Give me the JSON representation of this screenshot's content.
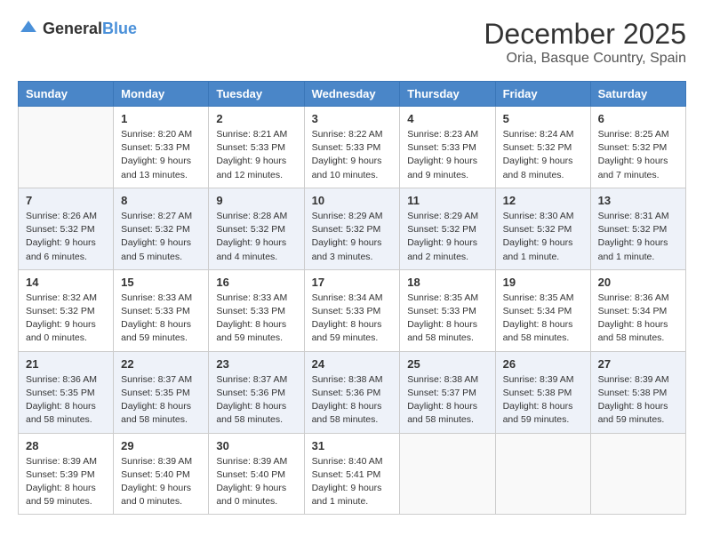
{
  "logo": {
    "general": "General",
    "blue": "Blue"
  },
  "title": {
    "month": "December 2025",
    "location": "Oria, Basque Country, Spain"
  },
  "headers": [
    "Sunday",
    "Monday",
    "Tuesday",
    "Wednesday",
    "Thursday",
    "Friday",
    "Saturday"
  ],
  "weeks": [
    [
      {
        "day": "",
        "info": ""
      },
      {
        "day": "1",
        "info": "Sunrise: 8:20 AM\nSunset: 5:33 PM\nDaylight: 9 hours\nand 13 minutes."
      },
      {
        "day": "2",
        "info": "Sunrise: 8:21 AM\nSunset: 5:33 PM\nDaylight: 9 hours\nand 12 minutes."
      },
      {
        "day": "3",
        "info": "Sunrise: 8:22 AM\nSunset: 5:33 PM\nDaylight: 9 hours\nand 10 minutes."
      },
      {
        "day": "4",
        "info": "Sunrise: 8:23 AM\nSunset: 5:33 PM\nDaylight: 9 hours\nand 9 minutes."
      },
      {
        "day": "5",
        "info": "Sunrise: 8:24 AM\nSunset: 5:32 PM\nDaylight: 9 hours\nand 8 minutes."
      },
      {
        "day": "6",
        "info": "Sunrise: 8:25 AM\nSunset: 5:32 PM\nDaylight: 9 hours\nand 7 minutes."
      }
    ],
    [
      {
        "day": "7",
        "info": "Sunrise: 8:26 AM\nSunset: 5:32 PM\nDaylight: 9 hours\nand 6 minutes."
      },
      {
        "day": "8",
        "info": "Sunrise: 8:27 AM\nSunset: 5:32 PM\nDaylight: 9 hours\nand 5 minutes."
      },
      {
        "day": "9",
        "info": "Sunrise: 8:28 AM\nSunset: 5:32 PM\nDaylight: 9 hours\nand 4 minutes."
      },
      {
        "day": "10",
        "info": "Sunrise: 8:29 AM\nSunset: 5:32 PM\nDaylight: 9 hours\nand 3 minutes."
      },
      {
        "day": "11",
        "info": "Sunrise: 8:29 AM\nSunset: 5:32 PM\nDaylight: 9 hours\nand 2 minutes."
      },
      {
        "day": "12",
        "info": "Sunrise: 8:30 AM\nSunset: 5:32 PM\nDaylight: 9 hours\nand 1 minute."
      },
      {
        "day": "13",
        "info": "Sunrise: 8:31 AM\nSunset: 5:32 PM\nDaylight: 9 hours\nand 1 minute."
      }
    ],
    [
      {
        "day": "14",
        "info": "Sunrise: 8:32 AM\nSunset: 5:32 PM\nDaylight: 9 hours\nand 0 minutes."
      },
      {
        "day": "15",
        "info": "Sunrise: 8:33 AM\nSunset: 5:33 PM\nDaylight: 8 hours\nand 59 minutes."
      },
      {
        "day": "16",
        "info": "Sunrise: 8:33 AM\nSunset: 5:33 PM\nDaylight: 8 hours\nand 59 minutes."
      },
      {
        "day": "17",
        "info": "Sunrise: 8:34 AM\nSunset: 5:33 PM\nDaylight: 8 hours\nand 59 minutes."
      },
      {
        "day": "18",
        "info": "Sunrise: 8:35 AM\nSunset: 5:33 PM\nDaylight: 8 hours\nand 58 minutes."
      },
      {
        "day": "19",
        "info": "Sunrise: 8:35 AM\nSunset: 5:34 PM\nDaylight: 8 hours\nand 58 minutes."
      },
      {
        "day": "20",
        "info": "Sunrise: 8:36 AM\nSunset: 5:34 PM\nDaylight: 8 hours\nand 58 minutes."
      }
    ],
    [
      {
        "day": "21",
        "info": "Sunrise: 8:36 AM\nSunset: 5:35 PM\nDaylight: 8 hours\nand 58 minutes."
      },
      {
        "day": "22",
        "info": "Sunrise: 8:37 AM\nSunset: 5:35 PM\nDaylight: 8 hours\nand 58 minutes."
      },
      {
        "day": "23",
        "info": "Sunrise: 8:37 AM\nSunset: 5:36 PM\nDaylight: 8 hours\nand 58 minutes."
      },
      {
        "day": "24",
        "info": "Sunrise: 8:38 AM\nSunset: 5:36 PM\nDaylight: 8 hours\nand 58 minutes."
      },
      {
        "day": "25",
        "info": "Sunrise: 8:38 AM\nSunset: 5:37 PM\nDaylight: 8 hours\nand 58 minutes."
      },
      {
        "day": "26",
        "info": "Sunrise: 8:39 AM\nSunset: 5:38 PM\nDaylight: 8 hours\nand 59 minutes."
      },
      {
        "day": "27",
        "info": "Sunrise: 8:39 AM\nSunset: 5:38 PM\nDaylight: 8 hours\nand 59 minutes."
      }
    ],
    [
      {
        "day": "28",
        "info": "Sunrise: 8:39 AM\nSunset: 5:39 PM\nDaylight: 8 hours\nand 59 minutes."
      },
      {
        "day": "29",
        "info": "Sunrise: 8:39 AM\nSunset: 5:40 PM\nDaylight: 9 hours\nand 0 minutes."
      },
      {
        "day": "30",
        "info": "Sunrise: 8:39 AM\nSunset: 5:40 PM\nDaylight: 9 hours\nand 0 minutes."
      },
      {
        "day": "31",
        "info": "Sunrise: 8:40 AM\nSunset: 5:41 PM\nDaylight: 9 hours\nand 1 minute."
      },
      {
        "day": "",
        "info": ""
      },
      {
        "day": "",
        "info": ""
      },
      {
        "day": "",
        "info": ""
      }
    ]
  ]
}
